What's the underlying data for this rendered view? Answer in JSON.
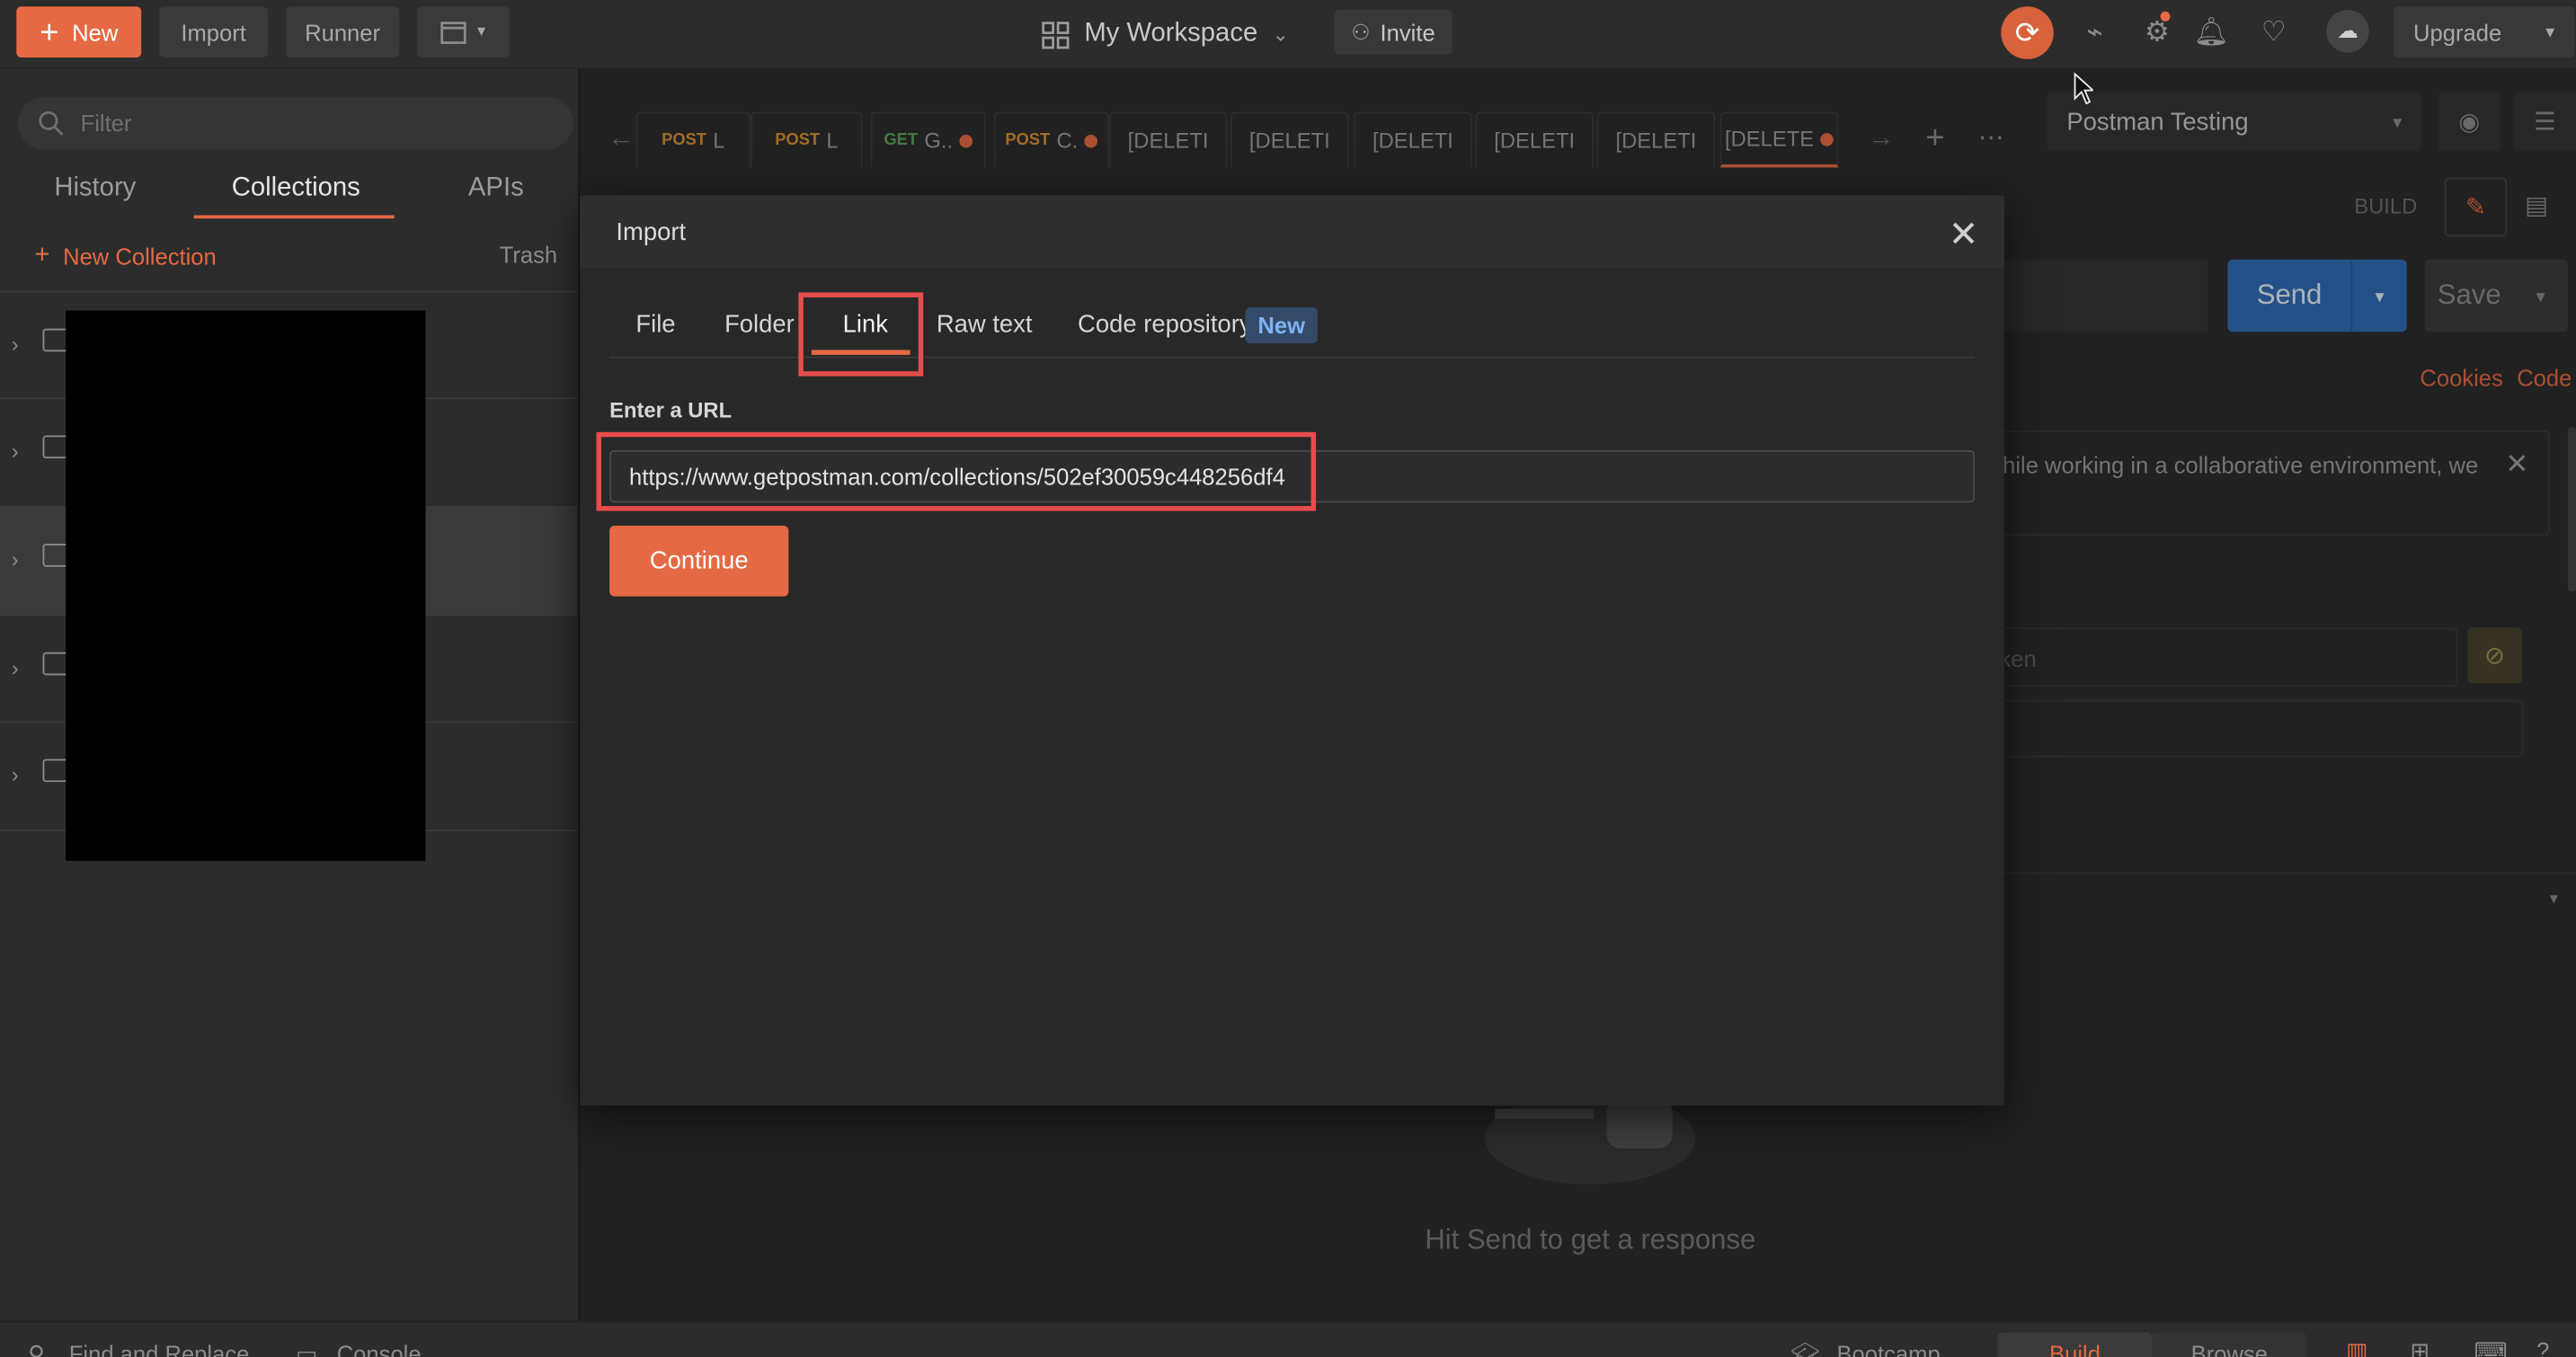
{
  "topbar": {
    "new_label": "New",
    "import_label": "Import",
    "runner_label": "Runner",
    "workspace_label": "My Workspace",
    "invite_label": "Invite",
    "upgrade_label": "Upgrade"
  },
  "sidebar": {
    "filter_placeholder": "Filter",
    "tabs": [
      "History",
      "Collections",
      "APIs"
    ],
    "active_tab": "Collections",
    "new_collection_label": "New Collection",
    "trash_label": "Trash"
  },
  "request_tabs": [
    {
      "method": "POST",
      "name": "L"
    },
    {
      "method": "POST",
      "name": "L"
    },
    {
      "method": "GET",
      "name": "G..",
      "unsaved": true
    },
    {
      "method": "POST",
      "name": "C.",
      "unsaved": true
    },
    {
      "method": "",
      "name": "[DELETI"
    },
    {
      "method": "",
      "name": "[DELETI"
    },
    {
      "method": "",
      "name": "[DELETI"
    },
    {
      "method": "",
      "name": "[DELETI"
    },
    {
      "method": "",
      "name": "[DELETI"
    },
    {
      "method": "",
      "name": "[DELETE",
      "unsaved": true,
      "active": true
    }
  ],
  "right_panel": {
    "environment": "Postman Testing",
    "build_label": "BUILD",
    "send_label": "Send",
    "save_label": "Save",
    "cookies_label": "Cookies",
    "code_label": "Code",
    "notice_text": "hile working in a collaborative environment, we",
    "token_fragment": "ken",
    "hit_send_text": "Hit Send to get a response"
  },
  "bottom_bar": {
    "find_replace": "Find and Replace",
    "console": "Console",
    "bootcamp": "Bootcamp",
    "build": "Build",
    "browse": "Browse"
  },
  "modal": {
    "title": "Import",
    "tabs": [
      "File",
      "Folder",
      "Link",
      "Raw text",
      "Code repository"
    ],
    "active_tab": "Link",
    "new_badge": "New",
    "url_label": "Enter a URL",
    "url_value": "https://www.getpostman.com/collections/502ef30059c448256df4",
    "continue_label": "Continue"
  },
  "colors": {
    "accent": "#e56a43",
    "send_blue": "#2f6cb4",
    "annotation_red": "#e84c4c"
  }
}
